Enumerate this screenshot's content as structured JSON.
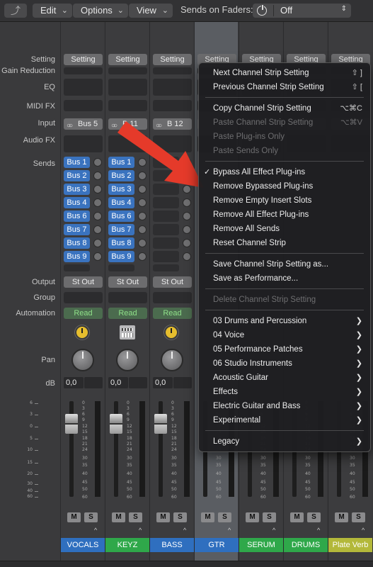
{
  "toolbar": {
    "edit": "Edit",
    "options": "Options",
    "view": "View",
    "sends_on_faders_label": "Sends on Faders:",
    "sends_on_faders_value": "Off"
  },
  "row_labels": {
    "setting": "Setting",
    "gain_reduction": "Gain Reduction",
    "eq": "EQ",
    "midi_fx": "MIDI FX",
    "input": "Input",
    "audio_fx": "Audio FX",
    "sends": "Sends",
    "output": "Output",
    "group": "Group",
    "automation": "Automation",
    "pan": "Pan",
    "db": "dB"
  },
  "strips": [
    {
      "name": "VOCALS",
      "color": "#2f6fbf",
      "input": "Bus 5",
      "output": "St Out",
      "automation": "Read",
      "db": "0,0",
      "sends": [
        "Bus 1",
        "Bus 2",
        "Bus 3",
        "Bus 4",
        "Bus 6",
        "Bus 7",
        "Bus 8",
        "Bus 9"
      ]
    },
    {
      "name": "KEYZ",
      "color": "#2fa84a",
      "input": "B 11",
      "output": "St Out",
      "automation": "Read",
      "db": "0,0",
      "sends": [
        "Bus 1",
        "Bus 2",
        "Bus 3",
        "Bus 4",
        "Bus 6",
        "Bus 7",
        "Bus 8",
        "Bus 9"
      ]
    },
    {
      "name": "BASS",
      "color": "#2f6fbf",
      "input": "B 12",
      "output": "St Out",
      "automation": "Read",
      "db": "0,0"
    },
    {
      "name": "GTR",
      "color": "#2f6fbf"
    },
    {
      "name": "SERUM",
      "color": "#2fa84a"
    },
    {
      "name": "DRUMS",
      "color": "#2fa84a"
    },
    {
      "name": "Plate Verb",
      "color": "#b3b83a"
    }
  ],
  "setting_label": "Setting",
  "mute_label": "M",
  "solo_label": "S",
  "fader_scale": [
    "0",
    "3",
    "6",
    "9",
    "12",
    "15",
    "18",
    "21",
    "24",
    "30",
    "35",
    "40",
    "45",
    "50",
    "60"
  ],
  "left_scale": [
    "6",
    "3",
    "0",
    "5",
    "10",
    "15",
    "20",
    "30",
    "40",
    "60"
  ],
  "context_menu": {
    "items": [
      {
        "label": "Next Channel Strip Setting",
        "shortcut": "⇧ ]",
        "enabled": true
      },
      {
        "label": "Previous Channel Strip Setting",
        "shortcut": "⇧ [",
        "enabled": true
      },
      {
        "label": "Copy Channel Strip Setting",
        "shortcut": "⌥⌘C",
        "enabled": true
      },
      {
        "label": "Paste Channel Strip Setting",
        "shortcut": "⌥⌘V",
        "enabled": false
      },
      {
        "label": "Paste Plug-ins Only",
        "enabled": false
      },
      {
        "label": "Paste Sends Only",
        "enabled": false
      },
      {
        "label": "Bypass All Effect Plug-ins",
        "checked": true,
        "enabled": true
      },
      {
        "label": "Remove Bypassed Plug-ins",
        "enabled": true
      },
      {
        "label": "Remove Empty Insert Slots",
        "enabled": true
      },
      {
        "label": "Remove All Effect Plug-ins",
        "enabled": true
      },
      {
        "label": "Remove All Sends",
        "enabled": true
      },
      {
        "label": "Reset Channel Strip",
        "enabled": true
      },
      {
        "label": "Save Channel Strip Setting as...",
        "enabled": true
      },
      {
        "label": "Save as Performance...",
        "enabled": true
      },
      {
        "label": "Delete Channel Strip Setting",
        "enabled": false
      },
      {
        "label": "03 Drums and Percussion",
        "submenu": true
      },
      {
        "label": "04 Voice",
        "submenu": true
      },
      {
        "label": "05 Performance Patches",
        "submenu": true
      },
      {
        "label": "06 Studio Instruments",
        "submenu": true
      },
      {
        "label": "Acoustic Guitar",
        "submenu": true
      },
      {
        "label": "Effects",
        "submenu": true
      },
      {
        "label": "Electric Guitar and Bass",
        "submenu": true
      },
      {
        "label": "Experimental",
        "submenu": true
      },
      {
        "label": "Legacy",
        "submenu": true
      }
    ]
  },
  "colors": {
    "send_blue": "#3a73bf",
    "read_green": "#8fe089",
    "arrow_red": "#e53a2a"
  }
}
